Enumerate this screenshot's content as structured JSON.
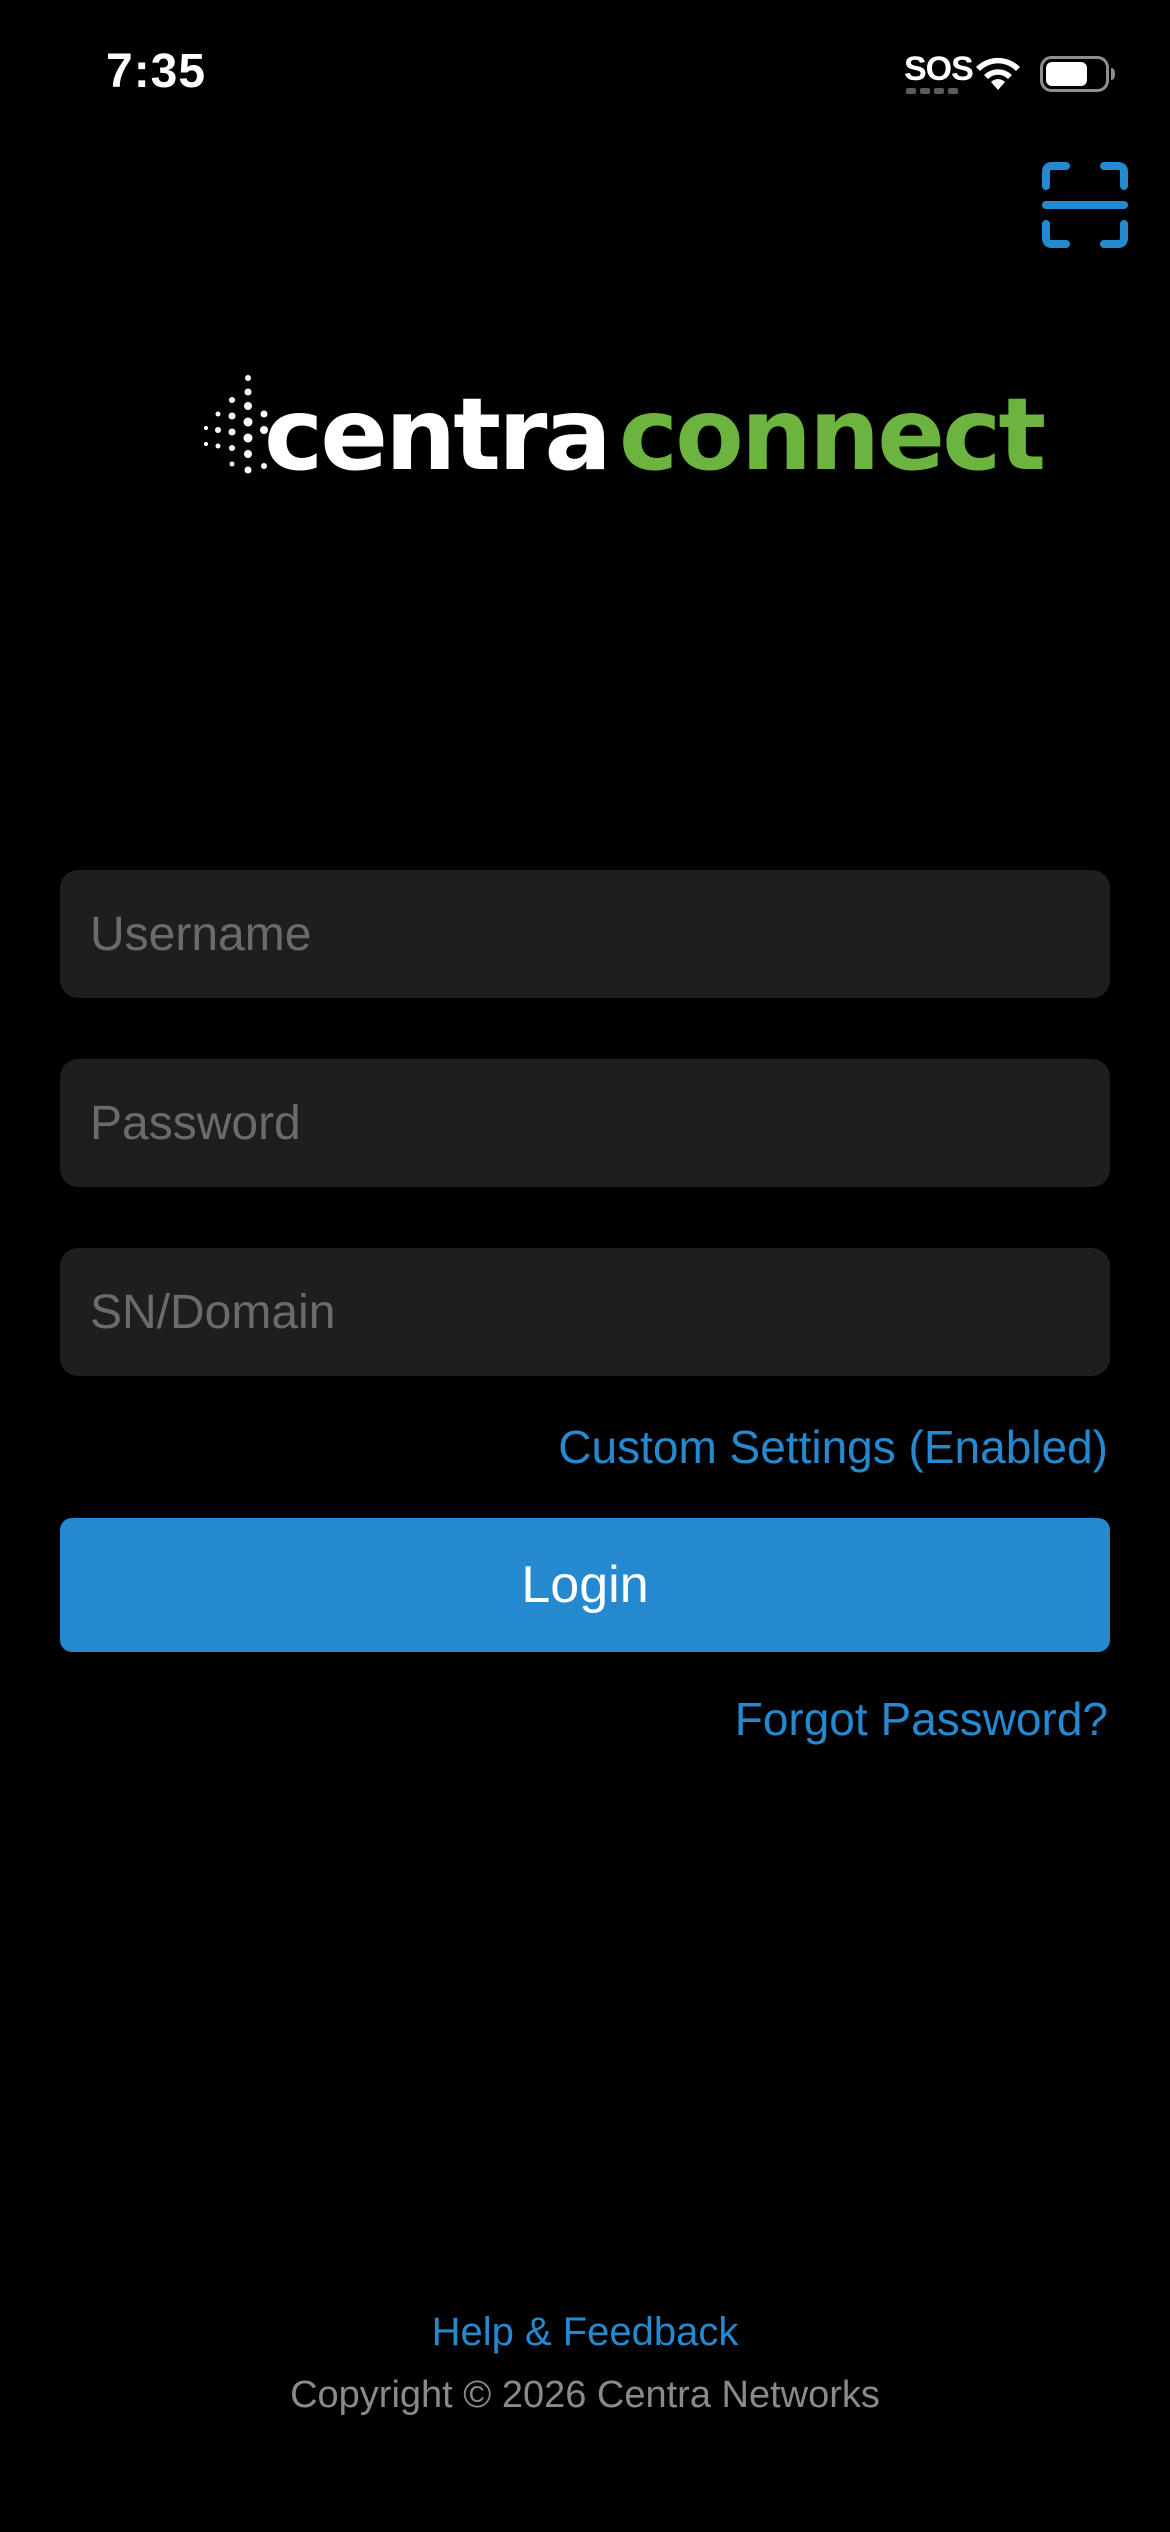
{
  "status_bar": {
    "time": "7:35",
    "sos": "SOS",
    "wifi_icon": "wifi-icon",
    "battery_icon": "battery-icon",
    "battery_level": 0.7
  },
  "header": {
    "scan_icon": "scan-icon",
    "accent_color": "#2589d0"
  },
  "logo": {
    "part1": "centra",
    "part2": "connect",
    "part1_color": "#ffffff",
    "part2_color": "#6db33f"
  },
  "form": {
    "username": {
      "value": "",
      "placeholder": "Username"
    },
    "password": {
      "value": "",
      "placeholder": "Password"
    },
    "domain": {
      "value": "",
      "placeholder": "SN/Domain"
    },
    "custom_settings_label": "Custom Settings (Enabled)",
    "login_label": "Login",
    "forgot_password_label": "Forgot Password?"
  },
  "footer": {
    "help_label": "Help & Feedback",
    "copyright": "Copyright © 2026 Centra Networks"
  }
}
